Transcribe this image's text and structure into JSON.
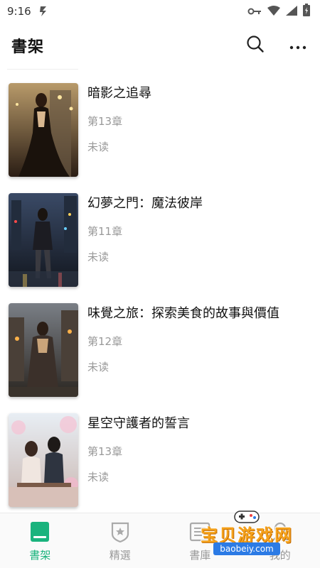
{
  "status_bar": {
    "time": "9:16"
  },
  "header": {
    "title": "書架",
    "icons": [
      "search-icon",
      "more-icon"
    ]
  },
  "books": [
    {
      "title": "暗影之追尋",
      "chapter": "第13章",
      "status": "未读"
    },
    {
      "title": "幻夢之門：魔法彼岸",
      "chapter": "第11章",
      "status": "未读"
    },
    {
      "title": "味覺之旅：探索美食的故事與價值",
      "chapter": "第12章",
      "status": "未读"
    },
    {
      "title": "星空守護者的誓言",
      "chapter": "第13章",
      "status": "未读"
    }
  ],
  "bottom_nav": {
    "items": [
      {
        "label": "書架",
        "icon": "bookshelf-icon",
        "active": true
      },
      {
        "label": "精選",
        "icon": "featured-icon",
        "active": false
      },
      {
        "label": "書庫",
        "icon": "library-icon",
        "active": false
      },
      {
        "label": "我的",
        "icon": "profile-icon",
        "active": false
      }
    ]
  },
  "watermark": {
    "text": "宝贝游戏网",
    "url": "baobeiy.com"
  },
  "colors": {
    "accent": "#1ab37d",
    "inactive": "#999999",
    "watermark": "#f5a21b"
  }
}
